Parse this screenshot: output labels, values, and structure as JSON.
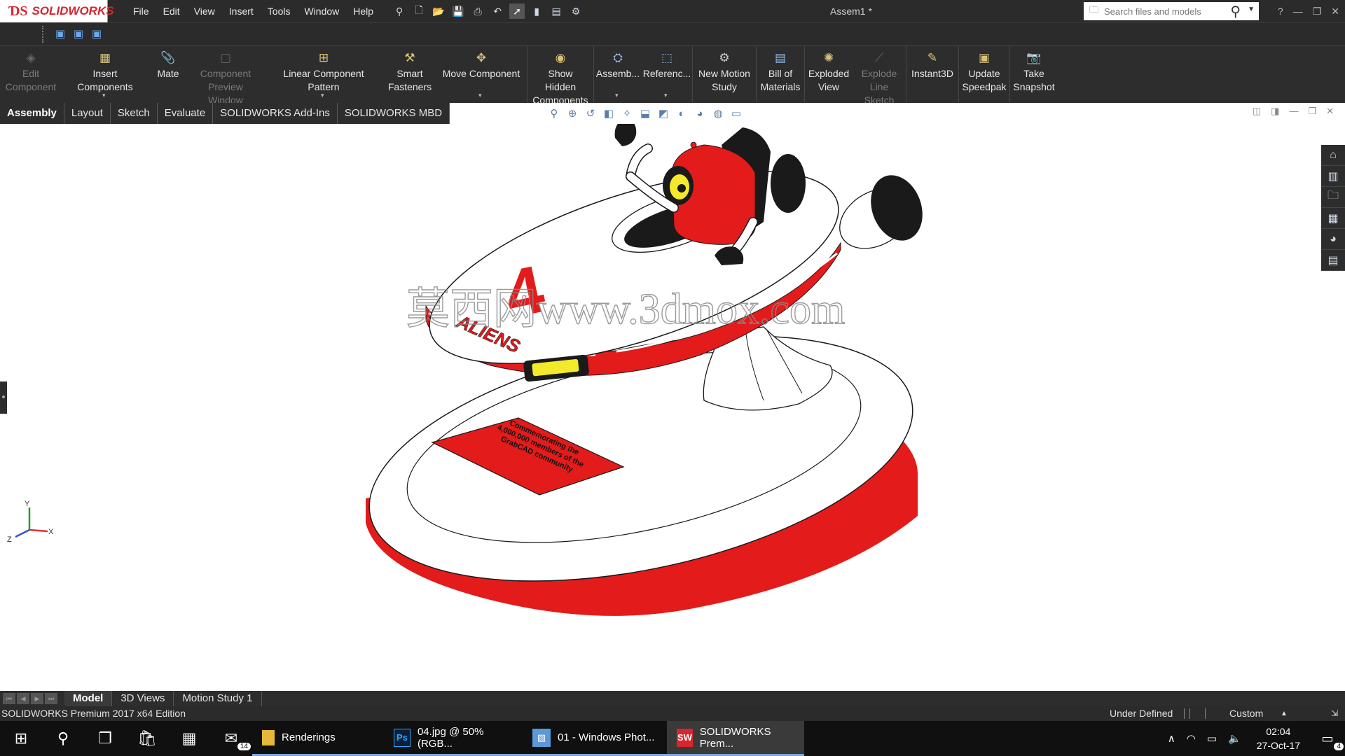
{
  "app": {
    "brand": "SOLIDWORKS",
    "doc_title": "Assem1 *"
  },
  "menu": [
    "File",
    "Edit",
    "View",
    "Insert",
    "Tools",
    "Window",
    "Help"
  ],
  "search": {
    "placeholder": "Search files and models"
  },
  "commands": [
    {
      "label": "Edit Component",
      "enabled": false,
      "icon": "edit-component-icon"
    },
    {
      "label": "Insert Components",
      "enabled": true,
      "icon": "insert-components-icon"
    },
    {
      "label": "Mate",
      "enabled": true,
      "icon": "mate-icon"
    },
    {
      "label": "Component Preview Window",
      "enabled": false,
      "icon": "component-preview-icon"
    },
    {
      "label": "Linear Component Pattern",
      "enabled": true,
      "icon": "linear-pattern-icon"
    },
    {
      "label": "Smart Fasteners",
      "enabled": true,
      "icon": "smart-fasteners-icon"
    },
    {
      "label": "Move Component",
      "enabled": true,
      "icon": "move-component-icon"
    },
    {
      "label": "Show Hidden Components",
      "enabled": true,
      "icon": "show-hidden-icon"
    },
    {
      "label": "Assemb...",
      "enabled": true,
      "icon": "assembly-features-icon"
    },
    {
      "label": "Referenc...",
      "enabled": true,
      "icon": "reference-geometry-icon"
    },
    {
      "label": "New Motion Study",
      "enabled": true,
      "icon": "motion-study-icon"
    },
    {
      "label": "Bill of Materials",
      "enabled": true,
      "icon": "bill-of-materials-icon"
    },
    {
      "label": "Exploded View",
      "enabled": true,
      "icon": "exploded-view-icon"
    },
    {
      "label": "Explode Line Sketch",
      "enabled": false,
      "icon": "explode-line-sketch-icon"
    },
    {
      "label": "Instant3D",
      "enabled": true,
      "icon": "instant3d-icon"
    },
    {
      "label": "Update Speedpak",
      "enabled": true,
      "icon": "speedpak-icon"
    },
    {
      "label": "Take Snapshot",
      "enabled": true,
      "icon": "camera-icon"
    }
  ],
  "tabs": [
    "Assembly",
    "Layout",
    "Sketch",
    "Evaluate",
    "SOLIDWORKS Add-Ins",
    "SOLIDWORKS MBD"
  ],
  "active_tab": "Assembly",
  "model": {
    "logo_letter": "4",
    "logo_word": "ALIENS",
    "plaque_text": "Commemorating the 4,000,000 members of the GrabCAD community",
    "watermark": "莫西网www.3dmox.com",
    "colors": {
      "red": "#e31b1b",
      "yellow": "#f2ea2a",
      "black": "#1a1a1a"
    }
  },
  "triad": {
    "x": "X",
    "y": "Y",
    "z": "Z"
  },
  "bottom_tabs": [
    "Model",
    "3D Views",
    "Motion Study 1"
  ],
  "active_bottom_tab": "Model",
  "status": {
    "edition": "SOLIDWORKS Premium 2017 x64 Edition",
    "state": "Under Defined",
    "units": "Custom"
  },
  "taskbar": {
    "apps": [
      {
        "label": "Renderings",
        "icon": "folder-icon"
      },
      {
        "label": "04.jpg @ 50% (RGB...",
        "icon": "photoshop-icon"
      },
      {
        "label": "01 - Windows Phot...",
        "icon": "photos-icon"
      },
      {
        "label": "SOLIDWORKS Prem...",
        "icon": "solidworks-icon"
      }
    ],
    "mail_badge": "14",
    "time": "02:04",
    "date": "27-Oct-17",
    "notif_badge": "4"
  }
}
